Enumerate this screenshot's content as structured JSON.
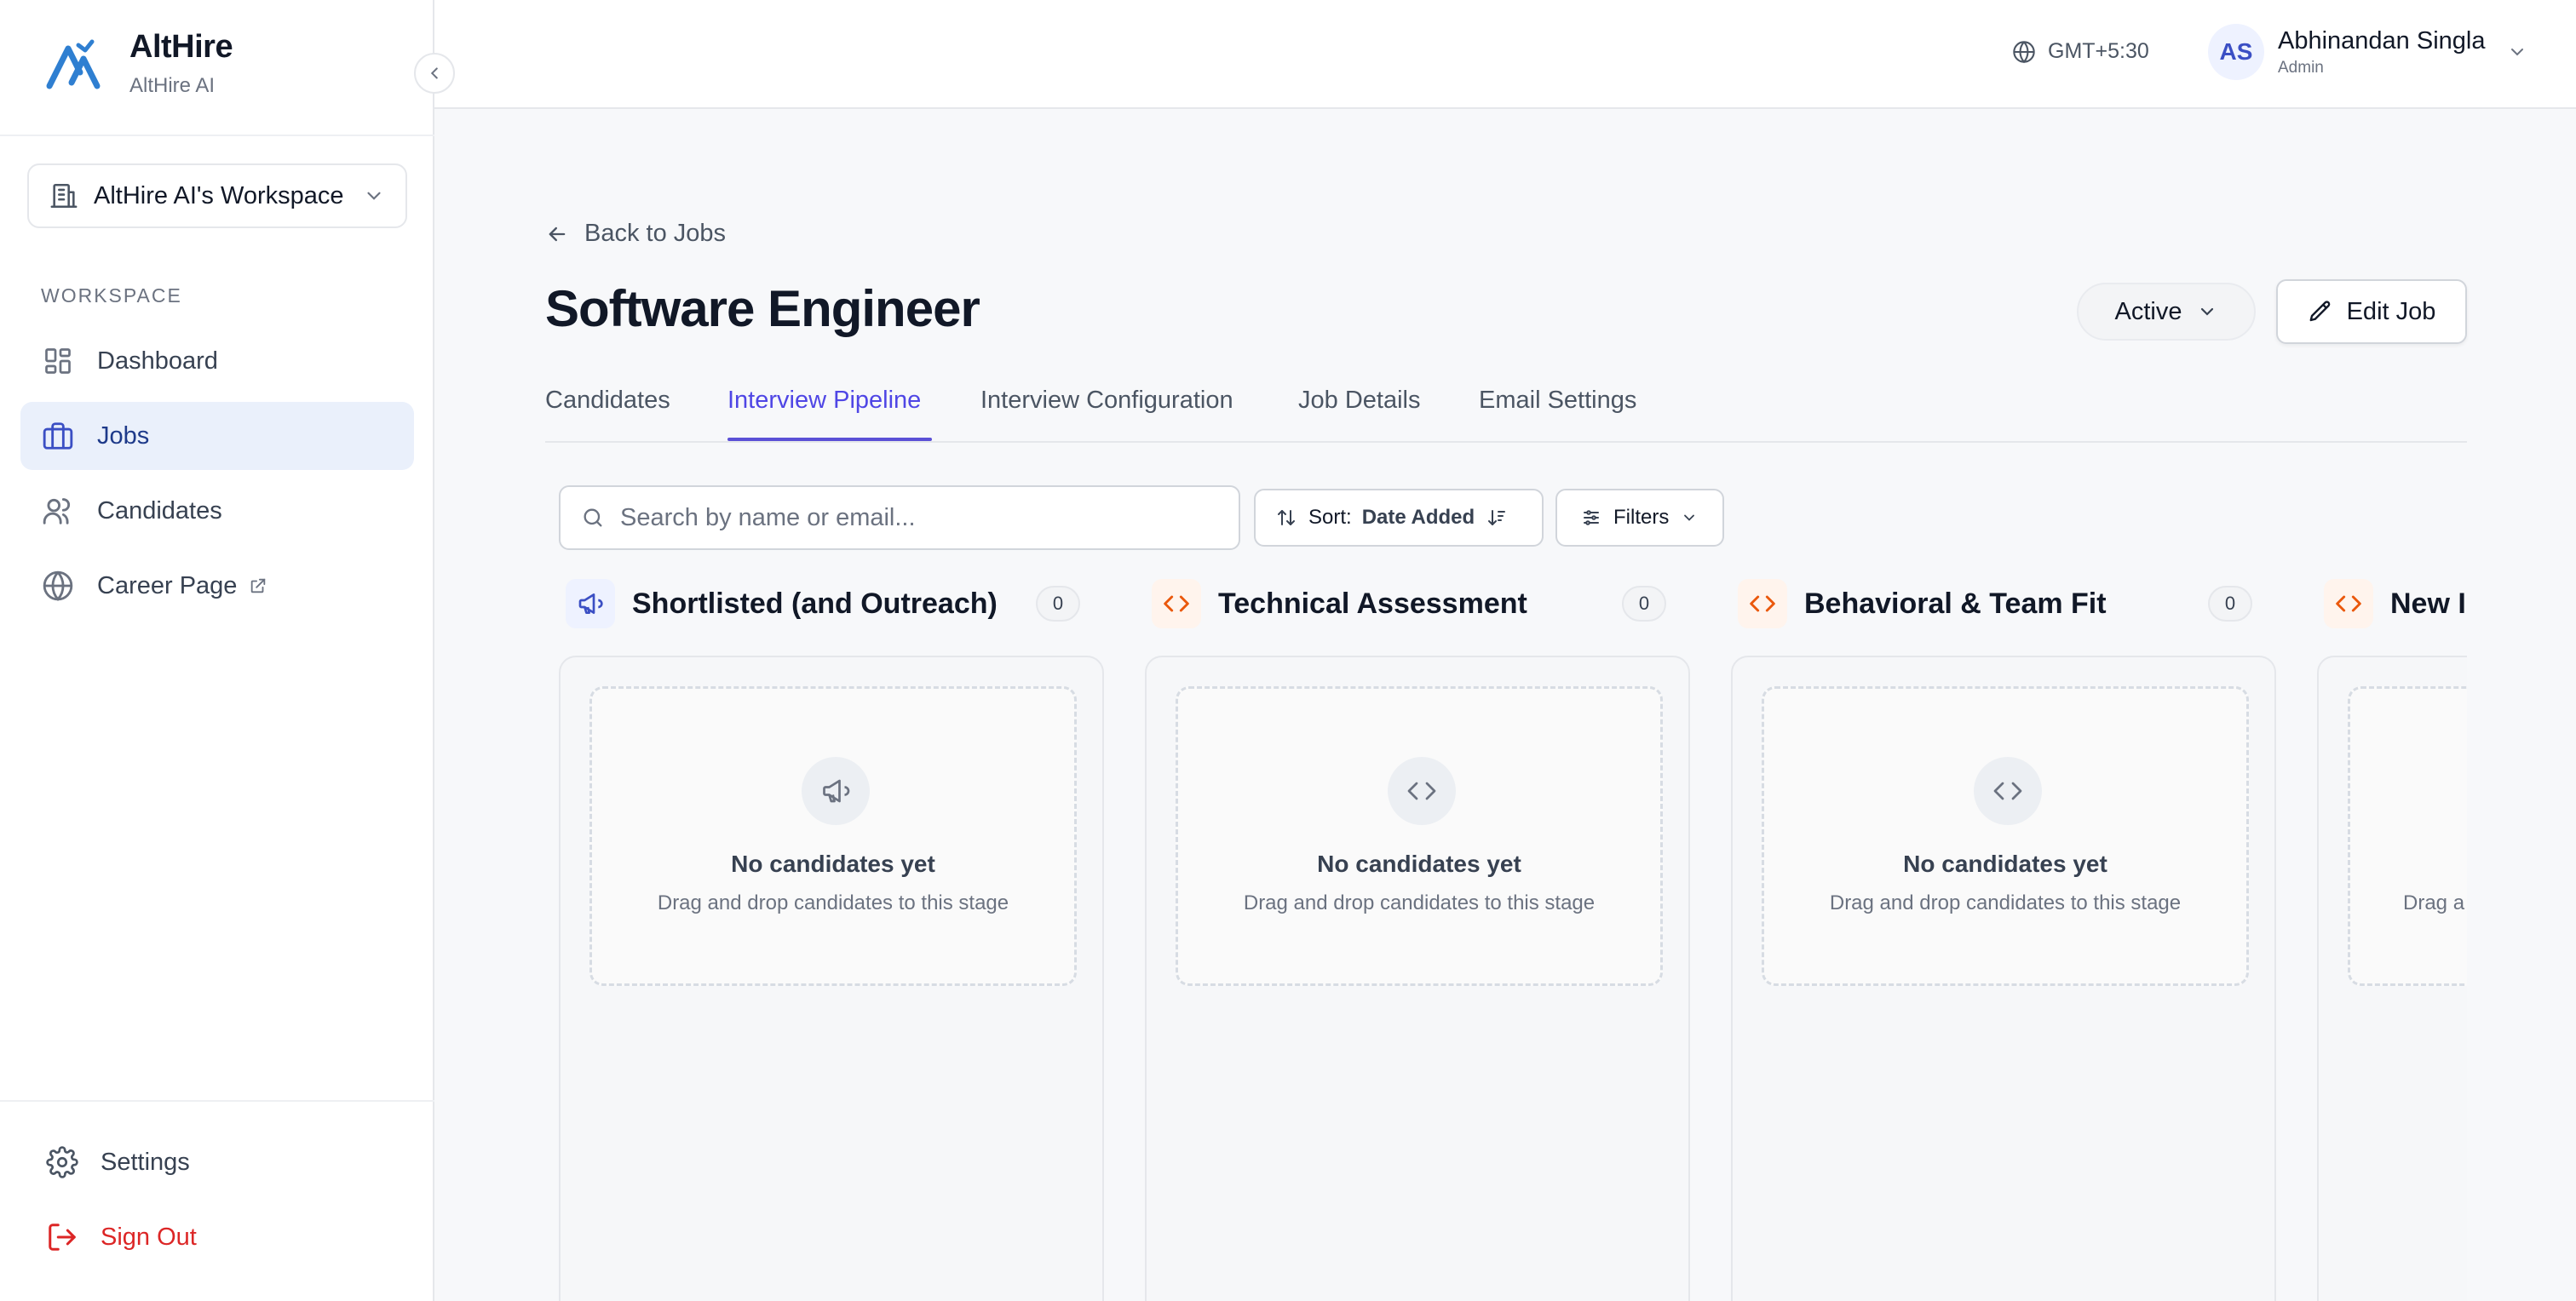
{
  "brand": {
    "name": "AltHire",
    "subtitle": "AltHire AI"
  },
  "workspace_selector": {
    "label": "AltHire AI's Workspace"
  },
  "sidebar": {
    "section_label": "WORKSPACE",
    "items": [
      {
        "label": "Dashboard",
        "icon": "dashboard-icon",
        "active": false
      },
      {
        "label": "Jobs",
        "icon": "briefcase-icon",
        "active": true
      },
      {
        "label": "Candidates",
        "icon": "users-icon",
        "active": false
      },
      {
        "label": "Career Page",
        "icon": "globe-icon",
        "active": false,
        "external": true
      }
    ],
    "settings_label": "Settings",
    "signout_label": "Sign Out"
  },
  "topbar": {
    "timezone": "GMT+5:30",
    "user": {
      "initials": "AS",
      "name": "Abhinandan Singla",
      "role": "Admin"
    }
  },
  "page": {
    "back_label": "Back to Jobs",
    "title": "Software Engineer",
    "status": "Active",
    "edit_label": "Edit Job"
  },
  "tabs": [
    {
      "label": "Candidates",
      "active": false
    },
    {
      "label": "Interview Pipeline",
      "active": true
    },
    {
      "label": "Interview Configuration",
      "active": false
    },
    {
      "label": "Job Details",
      "active": false
    },
    {
      "label": "Email Settings",
      "active": false
    }
  ],
  "toolbar": {
    "search_placeholder": "Search by name or email...",
    "search_value": "",
    "sort_label": "Sort:",
    "sort_value": "Date Added",
    "filters_label": "Filters"
  },
  "stages": [
    {
      "title": "Shortlisted (and Outreach)",
      "count": "0",
      "icon": "megaphone-icon",
      "empty_title": "No candidates yet",
      "empty_sub": "Drag and drop candidates to this stage"
    },
    {
      "title": "Technical Assessment",
      "count": "0",
      "icon": "code-icon",
      "empty_title": "No candidates yet",
      "empty_sub": "Drag and drop candidates to this stage"
    },
    {
      "title": "Behavioral & Team Fit",
      "count": "0",
      "icon": "code-icon",
      "empty_title": "No candidates yet",
      "empty_sub": "Drag and drop candidates to this stage"
    },
    {
      "title": "New In",
      "count": "",
      "icon": "code-icon",
      "empty_title": "",
      "empty_sub": "Drag a"
    }
  ],
  "colors": {
    "accent": "#4f46e5",
    "active_nav_bg": "#eaf0fb",
    "danger": "#dc2626",
    "stage_code": "#ea580c",
    "stage_megaphone": "#3b4fc4"
  }
}
